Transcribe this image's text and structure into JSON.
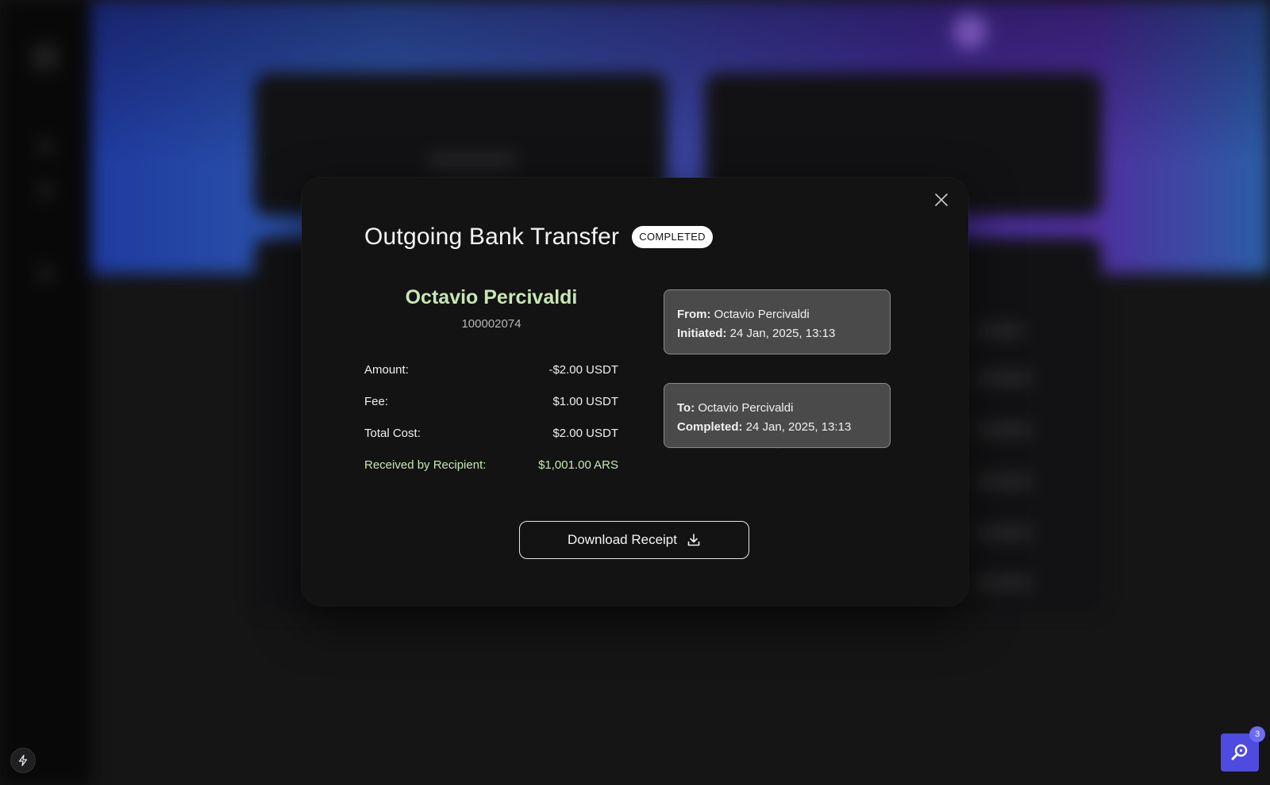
{
  "modal": {
    "title": "Outgoing Bank Transfer",
    "status_badge": "COMPLETED",
    "recipient": {
      "name": "Octavio Percivaldi",
      "account_number": "100002074"
    },
    "details": [
      {
        "label": "Amount:",
        "value": "-$2.00 USDT"
      },
      {
        "label": "Fee:",
        "value": "$1.00 USDT"
      },
      {
        "label": "Total Cost:",
        "value": "$2.00 USDT"
      },
      {
        "label": "Received by Recipient:",
        "value": "$1,001.00 ARS"
      }
    ],
    "from_card": {
      "from_label": "From:",
      "from_value": "Octavio Percivaldi",
      "initiated_label": "Initiated:",
      "initiated_value": "24 Jan, 2025, 13:13"
    },
    "to_card": {
      "to_label": "To:",
      "to_value": "Octavio Percivaldi",
      "completed_label": "Completed:",
      "completed_value": "24 Jan, 2025, 13:13"
    },
    "download_button_label": "Download Receipt"
  },
  "help_widget": {
    "badge_count": "3"
  },
  "colors": {
    "accent_green": "#c8e6b4",
    "help_button": "#4f4be0"
  },
  "icons": {
    "close": "close-icon",
    "download": "download-icon",
    "bolt": "bolt-icon",
    "help": "help-search-icon"
  }
}
